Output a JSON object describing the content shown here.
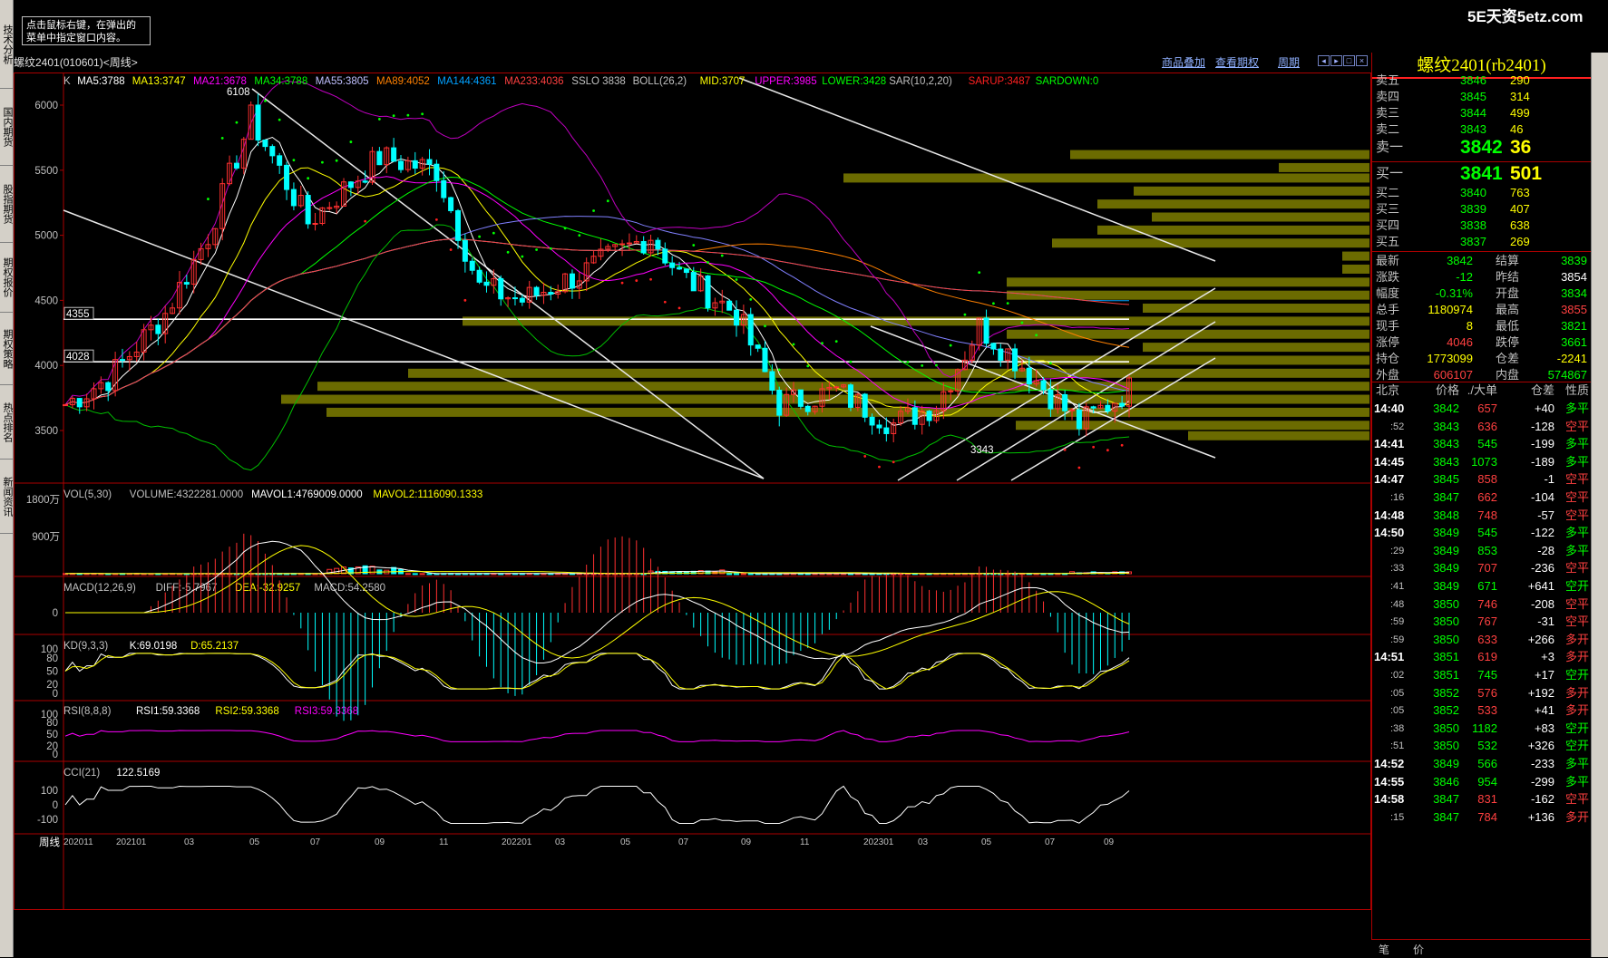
{
  "watermark": {
    "text": "5E天资5etz.com"
  },
  "left_tabs": [
    "技术分析",
    "国内期货",
    "股指期货",
    "期权报价",
    "期权策略",
    "热点排名",
    "新闻资讯"
  ],
  "tooltip": {
    "line1": "点击鼠标右键，在弹出的",
    "line2": "菜单中指定窗口内容。"
  },
  "header": {
    "title": "螺纹2401(010601)<周线>",
    "links": [
      "商品叠加",
      "查看期权",
      "周期"
    ]
  },
  "main_indicators": {
    "prefix": "K",
    "items": [
      {
        "text": "MA5:3788",
        "color": "#ffffff"
      },
      {
        "text": "MA13:3747",
        "color": "#ffff00"
      },
      {
        "text": "MA21:3678",
        "color": "#ff00ff"
      },
      {
        "text": "MA34:3788",
        "color": "#00ff00"
      },
      {
        "text": "MA55:3805",
        "color": "#c0c0ff"
      },
      {
        "text": "MA89:4052",
        "color": "#ff8000"
      },
      {
        "text": "MA144:4361",
        "color": "#00a0ff"
      },
      {
        "text": "MA233:4036",
        "color": "#ff4040"
      },
      {
        "text": "SSLO 3838",
        "color": "#c0c0c0"
      },
      {
        "text": "BOLL(26,2)",
        "color": "#c0c0c0"
      },
      {
        "text": "MID:3707",
        "color": "#ffff00"
      },
      {
        "text": "UPPER:3985",
        "color": "#ff00ff"
      },
      {
        "text": "LOWER:3428",
        "color": "#00ff00"
      },
      {
        "text": "SAR(10,2,20)",
        "color": "#c0c0c0"
      },
      {
        "text": "SARUP:3487",
        "color": "#ff2020"
      },
      {
        "text": "SARDOWN:0",
        "color": "#00ff00"
      }
    ]
  },
  "price_axis": [
    "6000",
    "5500",
    "5000",
    "4500",
    "4000",
    "3500"
  ],
  "price_markers": {
    "high_label": "6108",
    "low_label": "3343",
    "line1": "4355",
    "line2": "4028"
  },
  "vol_panel": {
    "label": "VOL(5,30)",
    "items": [
      {
        "text": "VOLUME:4322281.0000",
        "color": "#c0c0c0"
      },
      {
        "text": "MAVOL1:4769009.0000",
        "color": "#ffffff"
      },
      {
        "text": "MAVOL2:1116090.1333",
        "color": "#ffff00"
      }
    ],
    "axis": [
      "1800万",
      "900万"
    ]
  },
  "macd_panel": {
    "label": "MACD(12,26,9)",
    "items": [
      {
        "text": "DIFF:-5.7967",
        "color": "#c0c0c0"
      },
      {
        "text": "DEA:-32.9257",
        "color": "#ffff00"
      },
      {
        "text": "MACD:54.2580",
        "color": "#c0c0c0"
      }
    ],
    "axis": [
      "0"
    ]
  },
  "kd_panel": {
    "label": "KD(9,3,3)",
    "items": [
      {
        "text": "K:69.0198",
        "color": "#ffffff"
      },
      {
        "text": "D:65.2137",
        "color": "#ffff00"
      }
    ],
    "axis": [
      "100",
      "80",
      "50",
      "20",
      "0"
    ]
  },
  "rsi_panel": {
    "label": "RSI(8,8,8)",
    "items": [
      {
        "text": "RSI1:59.3368",
        "color": "#ffffff"
      },
      {
        "text": "RSI2:59.3368",
        "color": "#ffff00"
      },
      {
        "text": "RSI3:59.3368",
        "color": "#ff00ff"
      }
    ],
    "axis": [
      "100",
      "80",
      "50",
      "20",
      "0"
    ]
  },
  "cci_panel": {
    "label": "CCI(21)",
    "items": [
      {
        "text": "122.5169",
        "color": "#ffffff"
      }
    ],
    "axis": [
      "100",
      "0",
      "-100"
    ]
  },
  "time_axis": {
    "period": "周线",
    "labels": [
      "202011",
      "202101",
      "03",
      "05",
      "07",
      "09",
      "11",
      "202201",
      "03",
      "05",
      "07",
      "09",
      "11",
      "202301",
      "03",
      "05",
      "07",
      "09"
    ]
  },
  "quote_panel": {
    "title": "螺纹2401(rb2401)",
    "asks": [
      {
        "name": "卖五",
        "price": "3846",
        "vol": "290"
      },
      {
        "name": "卖四",
        "price": "3845",
        "vol": "314"
      },
      {
        "name": "卖三",
        "price": "3844",
        "vol": "499"
      },
      {
        "name": "卖二",
        "price": "3843",
        "vol": "46"
      },
      {
        "name": "卖一",
        "price": "3842",
        "vol": "36"
      }
    ],
    "bids": [
      {
        "name": "买一",
        "price": "3841",
        "vol": "501"
      },
      {
        "name": "买二",
        "price": "3840",
        "vol": "763"
      },
      {
        "name": "买三",
        "price": "3839",
        "vol": "407"
      },
      {
        "name": "买四",
        "price": "3838",
        "vol": "638"
      },
      {
        "name": "买五",
        "price": "3837",
        "vol": "269"
      }
    ],
    "stats": [
      {
        "l1": "最新",
        "v1": "3842",
        "c1": "#00ff00",
        "l2": "结算",
        "v2": "3839",
        "c2": "#00ff00"
      },
      {
        "l1": "涨跌",
        "v1": "-12",
        "c1": "#00ff00",
        "l2": "昨结",
        "v2": "3854",
        "c2": "#ffffff"
      },
      {
        "l1": "幅度",
        "v1": "-0.31%",
        "c1": "#00ff00",
        "l2": "开盘",
        "v2": "3834",
        "c2": "#00ff00"
      },
      {
        "l1": "总手",
        "v1": "1180974",
        "c1": "#ffff00",
        "l2": "最高",
        "v2": "3855",
        "c2": "#ff4040"
      },
      {
        "l1": "现手",
        "v1": "8",
        "c1": "#ffff00",
        "l2": "最低",
        "v2": "3821",
        "c2": "#00ff00"
      },
      {
        "l1": "涨停",
        "v1": "4046",
        "c1": "#ff4040",
        "l2": "跌停",
        "v2": "3661",
        "c2": "#00ff00"
      },
      {
        "l1": "持仓",
        "v1": "1773099",
        "c1": "#ffff00",
        "l2": "仓差",
        "v2": "-2241",
        "c2": "#ffff00"
      },
      {
        "l1": "外盘",
        "v1": "606107",
        "c1": "#ff4040",
        "l2": "内盘",
        "v2": "574867",
        "c2": "#00ff00"
      }
    ],
    "ticks_header": {
      "city": "北京",
      "price": "价格",
      "vol": "./大单",
      "oi": "仓差",
      "nature": "性质"
    },
    "ticks": [
      {
        "time": "14:40",
        "sub": false,
        "price": "3842",
        "pc": "#00ff00",
        "vol": "657",
        "vc": "#ff4040",
        "oi": "+40",
        "nature": "多平",
        "nc": "#00ff00"
      },
      {
        "time": ":52",
        "sub": true,
        "price": "3843",
        "pc": "#00ff00",
        "vol": "636",
        "vc": "#ff4040",
        "oi": "-128",
        "nature": "空平",
        "nc": "#ff4040"
      },
      {
        "time": "14:41",
        "sub": false,
        "price": "3843",
        "pc": "#00ff00",
        "vol": "545",
        "vc": "#00ff00",
        "oi": "-199",
        "nature": "多平",
        "nc": "#00ff00"
      },
      {
        "time": "14:45",
        "sub": false,
        "price": "3843",
        "pc": "#00ff00",
        "vol": "1073",
        "vc": "#00ff00",
        "oi": "-189",
        "nature": "多平",
        "nc": "#00ff00"
      },
      {
        "time": "14:47",
        "sub": false,
        "price": "3845",
        "pc": "#00ff00",
        "vol": "858",
        "vc": "#ff4040",
        "oi": "-1",
        "nature": "空平",
        "nc": "#ff4040"
      },
      {
        "time": ":16",
        "sub": true,
        "price": "3847",
        "pc": "#00ff00",
        "vol": "662",
        "vc": "#ff4040",
        "oi": "-104",
        "nature": "空平",
        "nc": "#ff4040"
      },
      {
        "time": "14:48",
        "sub": false,
        "price": "3848",
        "pc": "#00ff00",
        "vol": "748",
        "vc": "#ff4040",
        "oi": "-57",
        "nature": "空平",
        "nc": "#ff4040"
      },
      {
        "time": "14:50",
        "sub": false,
        "price": "3849",
        "pc": "#00ff00",
        "vol": "545",
        "vc": "#00ff00",
        "oi": "-122",
        "nature": "多平",
        "nc": "#00ff00"
      },
      {
        "time": ":29",
        "sub": true,
        "price": "3849",
        "pc": "#00ff00",
        "vol": "853",
        "vc": "#00ff00",
        "oi": "-28",
        "nature": "多平",
        "nc": "#00ff00"
      },
      {
        "time": ":33",
        "sub": true,
        "price": "3849",
        "pc": "#00ff00",
        "vol": "707",
        "vc": "#ff4040",
        "oi": "-236",
        "nature": "空平",
        "nc": "#ff4040"
      },
      {
        "time": ":41",
        "sub": true,
        "price": "3849",
        "pc": "#00ff00",
        "vol": "671",
        "vc": "#00ff00",
        "oi": "+641",
        "nature": "空开",
        "nc": "#00ff00"
      },
      {
        "time": ":48",
        "sub": true,
        "price": "3850",
        "pc": "#00ff00",
        "vol": "746",
        "vc": "#ff4040",
        "oi": "-208",
        "nature": "空平",
        "nc": "#ff4040"
      },
      {
        "time": ":59",
        "sub": true,
        "price": "3850",
        "pc": "#00ff00",
        "vol": "767",
        "vc": "#ff4040",
        "oi": "-31",
        "nature": "空平",
        "nc": "#ff4040"
      },
      {
        "time": ":59",
        "sub": true,
        "price": "3850",
        "pc": "#00ff00",
        "vol": "633",
        "vc": "#ff4040",
        "oi": "+266",
        "nature": "多开",
        "nc": "#ff4040"
      },
      {
        "time": "14:51",
        "sub": false,
        "price": "3851",
        "pc": "#00ff00",
        "vol": "619",
        "vc": "#ff4040",
        "oi": "+3",
        "nature": "多开",
        "nc": "#ff4040"
      },
      {
        "time": ":02",
        "sub": true,
        "price": "3851",
        "pc": "#00ff00",
        "vol": "745",
        "vc": "#00ff00",
        "oi": "+17",
        "nature": "空开",
        "nc": "#00ff00"
      },
      {
        "time": ":05",
        "sub": true,
        "price": "3852",
        "pc": "#00ff00",
        "vol": "576",
        "vc": "#ff4040",
        "oi": "+192",
        "nature": "多开",
        "nc": "#ff4040"
      },
      {
        "time": ":05",
        "sub": true,
        "price": "3852",
        "pc": "#00ff00",
        "vol": "533",
        "vc": "#ff4040",
        "oi": "+41",
        "nature": "多开",
        "nc": "#ff4040"
      },
      {
        "time": ":38",
        "sub": true,
        "price": "3850",
        "pc": "#00ff00",
        "vol": "1182",
        "vc": "#00ff00",
        "oi": "+83",
        "nature": "空开",
        "nc": "#00ff00"
      },
      {
        "time": ":51",
        "sub": true,
        "price": "3850",
        "pc": "#00ff00",
        "vol": "532",
        "vc": "#00ff00",
        "oi": "+326",
        "nature": "空开",
        "nc": "#00ff00"
      },
      {
        "time": "14:52",
        "sub": false,
        "price": "3849",
        "pc": "#00ff00",
        "vol": "566",
        "vc": "#00ff00",
        "oi": "-233",
        "nature": "多平",
        "nc": "#00ff00"
      },
      {
        "time": "14:55",
        "sub": false,
        "price": "3846",
        "pc": "#00ff00",
        "vol": "954",
        "vc": "#00ff00",
        "oi": "-299",
        "nature": "多平",
        "nc": "#00ff00"
      },
      {
        "time": "14:58",
        "sub": false,
        "price": "3847",
        "pc": "#00ff00",
        "vol": "831",
        "vc": "#ff4040",
        "oi": "-162",
        "nature": "空平",
        "nc": "#ff4040"
      },
      {
        "time": ":15",
        "sub": true,
        "price": "3847",
        "pc": "#00ff00",
        "vol": "784",
        "vc": "#ff4040",
        "oi": "+136",
        "nature": "多开",
        "nc": "#ff4040"
      }
    ],
    "bottom_tabs": [
      "笔",
      "价"
    ]
  }
}
